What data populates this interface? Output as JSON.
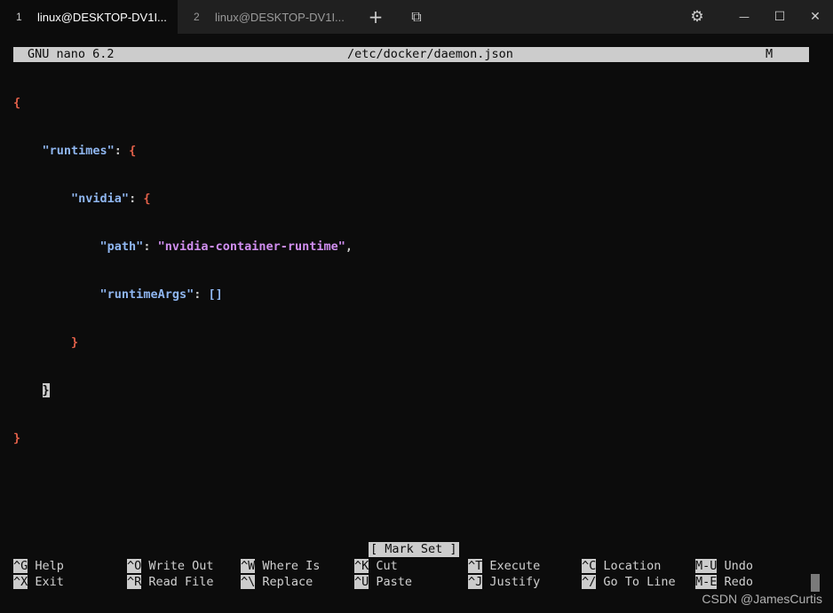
{
  "tabs": [
    {
      "num": "1",
      "label": "linux@DESKTOP-DV1I..."
    },
    {
      "num": "2",
      "label": "linux@DESKTOP-DV1I..."
    }
  ],
  "titlebar_icons": {
    "new_tab": "+",
    "dropdown": "⧉",
    "settings": "⚙",
    "minimize": "—",
    "maximize": "☐",
    "close": "✕"
  },
  "nano": {
    "version": "GNU nano 6.2",
    "filename": "/etc/docker/daemon.json",
    "modified": "M",
    "status": "[ Mark Set ]"
  },
  "code": {
    "l1_open": "{",
    "l2_key": "\"runtimes\"",
    "l2_punct": ": ",
    "l2_brace": "{",
    "l3_key": "\"nvidia\"",
    "l3_punct": ": ",
    "l3_brace": "{",
    "l4_key": "\"path\"",
    "l4_punct": ": ",
    "l4_value": "\"nvidia-container-runtime\"",
    "l4_comma": ",",
    "l5_key": "\"runtimeArgs\"",
    "l5_punct": ": ",
    "l5_value": "[]",
    "l6_close": "}",
    "l7_close": "}",
    "l8_close": "}"
  },
  "shortcuts": [
    {
      "key": "^G",
      "label": "Help"
    },
    {
      "key": "^O",
      "label": "Write Out"
    },
    {
      "key": "^W",
      "label": "Where Is"
    },
    {
      "key": "^K",
      "label": "Cut"
    },
    {
      "key": "^T",
      "label": "Execute"
    },
    {
      "key": "^C",
      "label": "Location"
    },
    {
      "key": "M-U",
      "label": "Undo"
    },
    {
      "key": "^X",
      "label": "Exit"
    },
    {
      "key": "^R",
      "label": "Read File"
    },
    {
      "key": "^\\",
      "label": "Replace"
    },
    {
      "key": "^U",
      "label": "Paste"
    },
    {
      "key": "^J",
      "label": "Justify"
    },
    {
      "key": "^/",
      "label": "Go To Line"
    },
    {
      "key": "M-E",
      "label": "Redo"
    }
  ],
  "watermark": "CSDN @JamesCurtis"
}
